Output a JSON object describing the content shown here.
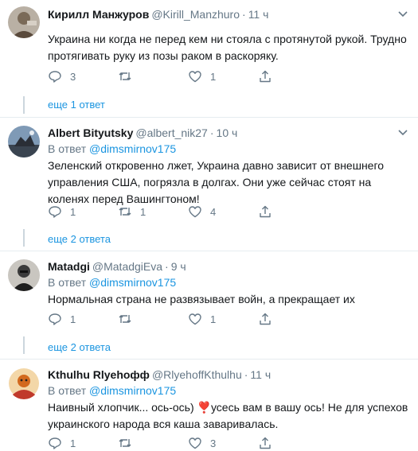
{
  "tweets": [
    {
      "name": "Кирилл Манжуров",
      "handle": "@Kirill_Manzhuro",
      "time": "11 ч",
      "reply_label": "",
      "reply_user": "",
      "text": "Украина ни когда не перед кем ни стояла с протянутой рукой. Трудно протягивать руку из позы раком в раскоряку.",
      "counts": {
        "reply": "3",
        "retweet": "",
        "like": "1"
      },
      "more": "еще 1 ответ"
    },
    {
      "name": "Albert Bityutsky",
      "handle": "@albert_nik27",
      "time": "10 ч",
      "reply_label": "В ответ",
      "reply_user": "@dimsmirnov175",
      "text": "Зеленский откровенно лжет, Украина давно зависит от внешнего управления США, погрязла в долгах. Они уже сейчас стоят на коленях перед Вашингтоном!",
      "counts": {
        "reply": "1",
        "retweet": "1",
        "like": "4"
      },
      "more": "еще 2 ответа"
    },
    {
      "name": "Matadgi",
      "handle": "@MatadgiEva",
      "time": "9 ч",
      "reply_label": "В ответ",
      "reply_user": "@dimsmirnov175",
      "text": "Нормальная страна не развязывает войн, а прекращает их",
      "counts": {
        "reply": "1",
        "retweet": "",
        "like": "1"
      },
      "more": "еще 2 ответа"
    },
    {
      "name": "Kthulhu Rlyehoфф",
      "handle": "@RlyehoffKthulhu",
      "time": "11 ч",
      "reply_label": "В ответ",
      "reply_user": "@dimsmirnov175",
      "text": "Наивный хлопчик... ось-ось) ❣️усесь вам в вашу ось! Не для успехов украинского народа вся каша заваривалась.",
      "counts": {
        "reply": "1",
        "retweet": "",
        "like": "3"
      },
      "more": ""
    }
  ],
  "icons": {
    "reply": "reply-icon",
    "retweet": "retweet-icon",
    "like": "heart-icon",
    "share": "share-icon",
    "menu": "chevron-down-icon"
  },
  "colors": {
    "link": "#1b95e0",
    "muted": "#657786",
    "divider": "#e6ecf0",
    "text": "#14171a"
  }
}
